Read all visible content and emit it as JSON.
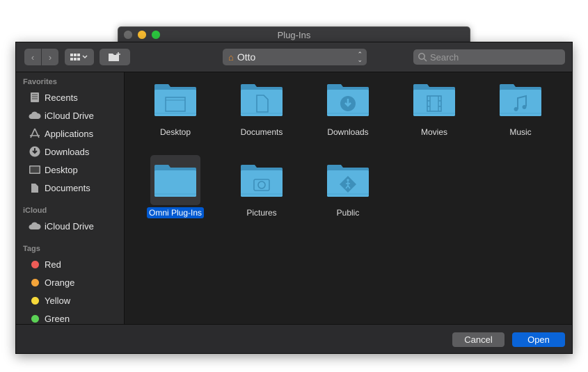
{
  "window": {
    "title": "Plug-Ins"
  },
  "toolbar": {
    "location": "Otto",
    "search_placeholder": "Search"
  },
  "sidebar": {
    "favorites_header": "Favorites",
    "favorites": [
      {
        "label": "Recents",
        "icon": "recents-icon"
      },
      {
        "label": "iCloud Drive",
        "icon": "cloud-icon"
      },
      {
        "label": "Applications",
        "icon": "applications-icon"
      },
      {
        "label": "Downloads",
        "icon": "downloads-icon"
      },
      {
        "label": "Desktop",
        "icon": "desktop-icon"
      },
      {
        "label": "Documents",
        "icon": "documents-icon"
      }
    ],
    "icloud_header": "iCloud",
    "icloud": [
      {
        "label": "iCloud Drive",
        "icon": "cloud-icon"
      }
    ],
    "tags_header": "Tags",
    "tags": [
      {
        "label": "Red",
        "color": "#ee5c57"
      },
      {
        "label": "Orange",
        "color": "#f4a43a"
      },
      {
        "label": "Yellow",
        "color": "#f7d93a"
      },
      {
        "label": "Green",
        "color": "#5bd155"
      }
    ]
  },
  "files": [
    {
      "label": "Desktop",
      "glyph": "desktop"
    },
    {
      "label": "Documents",
      "glyph": "document"
    },
    {
      "label": "Downloads",
      "glyph": "download"
    },
    {
      "label": "Movies",
      "glyph": "film"
    },
    {
      "label": "Music",
      "glyph": "music"
    },
    {
      "label": "Omni Plug-Ins",
      "glyph": "none",
      "selected": true
    },
    {
      "label": "Pictures",
      "glyph": "camera"
    },
    {
      "label": "Public",
      "glyph": "public"
    }
  ],
  "buttons": {
    "cancel": "Cancel",
    "open": "Open"
  },
  "colors": {
    "accent": "#0a64d8",
    "folder": "#5ab4e0"
  }
}
